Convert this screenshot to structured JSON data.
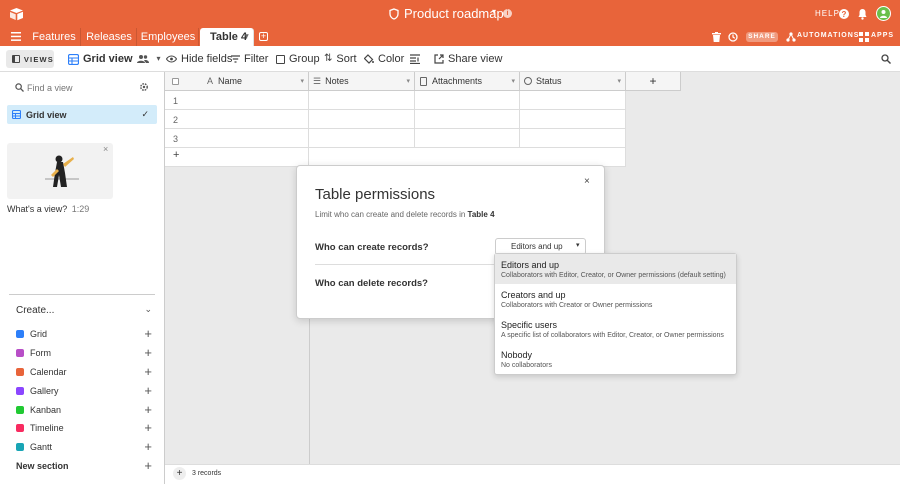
{
  "app": {
    "base_title": "Product roadmap",
    "help_label": "HELP",
    "share_label": "SHARE",
    "automations_label": "AUTOMATIONS",
    "apps_label": "APPS",
    "brand_color": "#e8643a"
  },
  "tabs": [
    "Features",
    "Releases",
    "Employees",
    "Table 4"
  ],
  "toolbar": {
    "views_label": "VIEWS",
    "view_name": "Grid view",
    "hide_fields": "Hide fields",
    "filter": "Filter",
    "group": "Group",
    "sort": "Sort",
    "color": "Color",
    "share_view": "Share view"
  },
  "sidebar": {
    "find_placeholder": "Find a view",
    "active_view": "Grid view",
    "video_caption": "What's a view?",
    "video_duration": "1:29",
    "create_label": "Create...",
    "items": [
      {
        "label": "Grid",
        "color": "#2d7ff9"
      },
      {
        "label": "Form",
        "color": "#b84ec7"
      },
      {
        "label": "Calendar",
        "color": "#e8643a"
      },
      {
        "label": "Gallery",
        "color": "#8b46ff"
      },
      {
        "label": "Kanban",
        "color": "#20c933"
      },
      {
        "label": "Timeline",
        "color": "#f82b60"
      },
      {
        "label": "Gantt",
        "color": "#18a5b5"
      }
    ],
    "new_section": "New section"
  },
  "grid": {
    "columns": [
      "Name",
      "Notes",
      "Attachments",
      "Status"
    ],
    "row_numbers": [
      "1",
      "2",
      "3"
    ],
    "record_count": "3 records"
  },
  "dialog": {
    "title": "Table permissions",
    "subtitle_prefix": "Limit who can create and delete records in",
    "table_name": "Table 4",
    "create_question": "Who can create records?",
    "delete_question": "Who can delete records?",
    "selected_option": "Editors and up"
  },
  "dropdown": {
    "options": [
      {
        "title": "Editors and up",
        "desc": "Collaborators with Editor, Creator, or Owner permissions (default setting)"
      },
      {
        "title": "Creators and up",
        "desc": "Collaborators with Creator or Owner permissions"
      },
      {
        "title": "Specific users",
        "desc": "A specific list of collaborators with Editor, Creator, or Owner permissions"
      },
      {
        "title": "Nobody",
        "desc": "No collaborators"
      }
    ]
  }
}
